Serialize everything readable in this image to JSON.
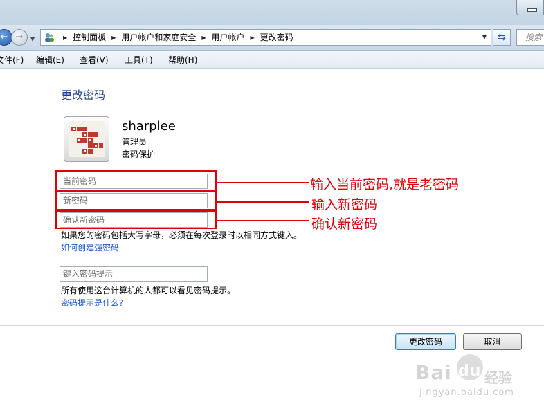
{
  "address_bar": {
    "breadcrumbs": [
      "控制面板",
      "用户帐户和家庭安全",
      "用户帐户",
      "更改密码"
    ],
    "search_placeholder": "搜索"
  },
  "menu": [
    "文件(F)",
    "编辑(E)",
    "查看(V)",
    "工具(T)",
    "帮助(H)"
  ],
  "page": {
    "title": "更改密码",
    "user": {
      "name": "sharplee",
      "role": "管理员",
      "protection": "密码保护"
    },
    "fields": {
      "current_password_placeholder": "当前密码",
      "new_password_placeholder": "新密码",
      "confirm_password_placeholder": "确认新密码",
      "hint_placeholder": "键入密码提示"
    },
    "case_note": "如果您的密码包括大写字母，必须在每次登录时以相同方式键入。",
    "strong_password_link": "如何创建强密码",
    "hint_note": "所有使用这台计算机的人都可以看见密码提示。",
    "hint_link": "密码提示是什么?"
  },
  "buttons": {
    "change_password": "更改密码",
    "cancel": "取消"
  },
  "annotations": {
    "current": "输入当前密码,就是老密码",
    "new": "输入新密码",
    "confirm": "确认新密码",
    "color": "#e0000a"
  },
  "watermark": {
    "brand": "Bai",
    "brand2": "du",
    "brand_cn": "经验",
    "url": "jingyan.baidu.com"
  },
  "colors": {
    "title": "#1e3f8a",
    "link": "#1a5ad0"
  }
}
